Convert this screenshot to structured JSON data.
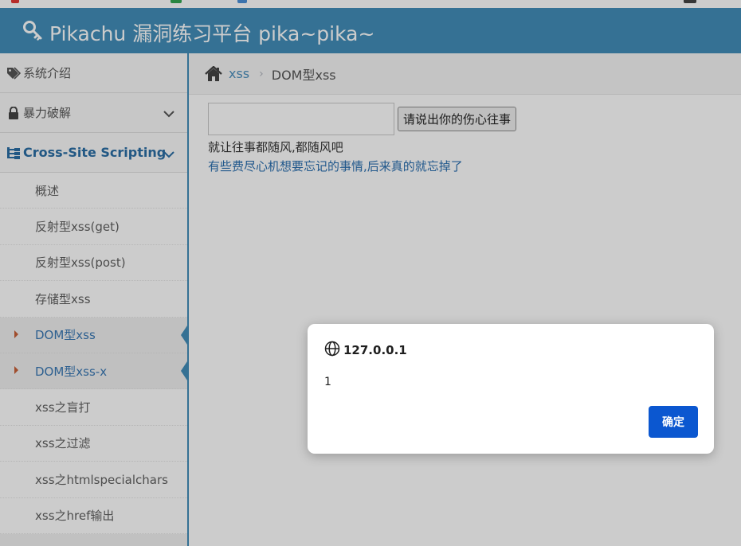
{
  "brand": {
    "title": "Pikachu 漏洞练习平台 pika~pika~"
  },
  "sidebar": {
    "top_items": [
      {
        "label": "系统介绍"
      },
      {
        "label": "暴力破解"
      },
      {
        "label": "Cross-Site Scripting"
      }
    ],
    "sub_items": [
      {
        "label": "概述"
      },
      {
        "label": "反射型xss(get)"
      },
      {
        "label": "反射型xss(post)"
      },
      {
        "label": "存储型xss"
      },
      {
        "label": "DOM型xss"
      },
      {
        "label": "DOM型xss-x"
      },
      {
        "label": "xss之盲打"
      },
      {
        "label": "xss之过滤"
      },
      {
        "label": "xss之htmlspecialchars"
      },
      {
        "label": "xss之href输出"
      }
    ]
  },
  "breadcrumb": {
    "link": "xss",
    "separator": "›",
    "current": "DOM型xss"
  },
  "form": {
    "input_value": "",
    "button_label": "请说出你的伤心往事",
    "line1": "就让往事都随风,都随风吧",
    "line2": "有些费尽心机想要忘记的事情,后来真的就忘掉了"
  },
  "dialog": {
    "origin": "127.0.0.1",
    "message": "1",
    "ok_label": "确定"
  },
  "colors": {
    "navbar": "#438eb9",
    "accent_blue": "#2b6ea5",
    "dialog_button": "#0b57d0",
    "caret": "#c86139"
  }
}
